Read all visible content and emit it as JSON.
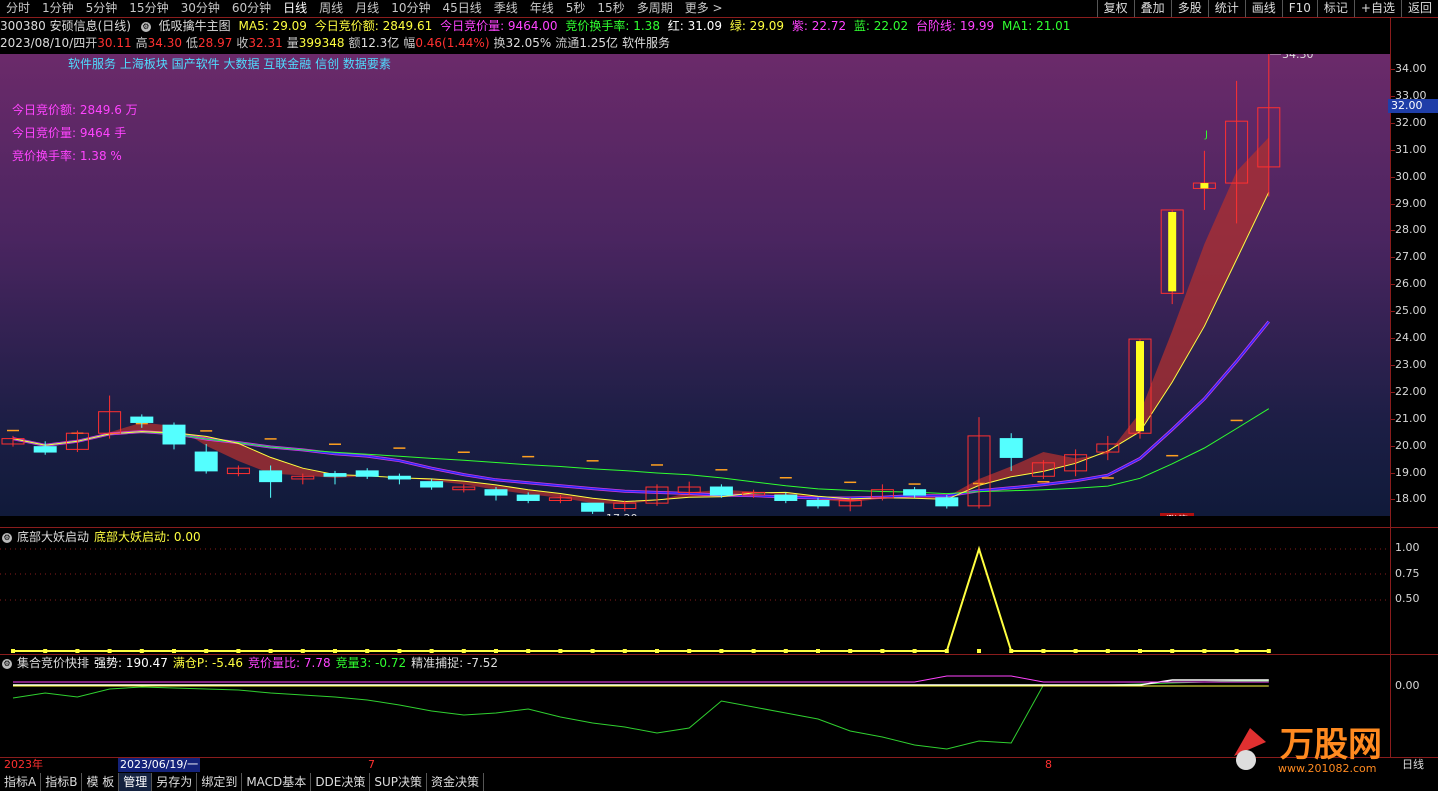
{
  "toolbar": {
    "tabs": [
      "分时",
      "1分钟",
      "5分钟",
      "15分钟",
      "30分钟",
      "60分钟",
      "日线",
      "周线",
      "月线",
      "10分钟",
      "45日线",
      "季线",
      "年线",
      "5秒",
      "15秒",
      "多周期",
      "更多 >"
    ],
    "active_tab": "日线",
    "right_buttons": [
      "复权",
      "叠加",
      "多股",
      "统计",
      "画线",
      "F10",
      "标记",
      "+自选",
      "返回"
    ]
  },
  "header": {
    "stock": "300380 安硕信息(日线)",
    "indicator": "低吸擒牛主图",
    "ma5": "MA5: 29.09",
    "auction_amount": "今日竞价额: 2849.61",
    "auction_volume": "今日竞价量: 9464.00",
    "auction_turnover": "竞价换手率: 1.38",
    "red": "红: 31.09",
    "green": "绿: 29.09",
    "purple": "紫: 22.72",
    "blue": "蓝: 22.02",
    "step_line": "台阶线: 19.99",
    "ma1": "MA1: 21.01"
  },
  "quote": {
    "date": "2023/08/10/四",
    "open_label": "开",
    "open": "30.11",
    "high_label": "高",
    "high": "34.30",
    "low_label": "低",
    "low": "28.97",
    "close_label": "收",
    "close": "32.31",
    "vol_label": "量",
    "vol": "399348",
    "amount_label": "额",
    "amount": "12.3亿",
    "change_label": "幅",
    "change": "0.46(1.44%)",
    "turnover_label": "换",
    "turnover": "32.05%",
    "float_label": "流通",
    "float": "1.25亿",
    "sector": "软件服务"
  },
  "concepts": "软件服务  上海板块  国产软件  大数据  互联金融  信创  数据要素",
  "stats": {
    "amount": "今日竞价额:  2849.6  万",
    "volume": "今日竞价量:  9464  手",
    "turnover": "竞价换手率:  1.38  %"
  },
  "price_axis": [
    "34.00",
    "33.00",
    "32.00",
    "31.00",
    "30.00",
    "29.00",
    "28.00",
    "27.00",
    "26.00",
    "25.00",
    "24.00",
    "23.00",
    "22.00",
    "21.00",
    "20.00",
    "19.00",
    "18.00"
  ],
  "current_price": "32.00",
  "high_marker": "34.30",
  "low_marker": "17.20",
  "limit_tag": "涨停",
  "j_marker": "J",
  "panel2": {
    "name": "底部大妖启动",
    "label": "底部大妖启动: 0.00",
    "axis": [
      "1.00",
      "0.75",
      "0.50"
    ]
  },
  "panel3": {
    "name": "集合竞价快排",
    "strength": "强势: 190.47",
    "full": "满仓P: -5.46",
    "ratio": "竞价量比: 7.78",
    "vol3": "竞量3: -0.72",
    "catch": "精准捕捉: -7.52",
    "axis": [
      "0.00"
    ]
  },
  "dates": {
    "year": "2023年",
    "cursor": "2023/06/19/一",
    "m7": "7",
    "m8": "8",
    "period": "日线"
  },
  "bottom_tabs": [
    "指标A",
    "指标B",
    "模 板",
    "管理",
    "另存为",
    "绑定到",
    "MACD基本",
    "DDE决策",
    "SUP决策",
    "资金决策"
  ],
  "active_bottom": "管理",
  "logo_text": "万股网",
  "logo_url": "www.201082.com",
  "colors": {
    "up": "#ff3030",
    "down": "#54ffff",
    "ma_yellow": "#ffff40",
    "magenta": "#ff44ff",
    "cyan": "#4fdcff",
    "green": "#30ff30"
  },
  "chart_data": {
    "type": "candlestick",
    "ylim": [
      17,
      34.5
    ],
    "candles": [
      {
        "o": 19.8,
        "c": 20.0,
        "h": 20.1,
        "l": 19.7
      },
      {
        "o": 19.7,
        "c": 19.5,
        "h": 19.9,
        "l": 19.4
      },
      {
        "o": 19.6,
        "c": 20.2,
        "h": 20.3,
        "l": 19.5
      },
      {
        "o": 20.2,
        "c": 21.0,
        "h": 21.6,
        "l": 20.0
      },
      {
        "o": 20.8,
        "c": 20.6,
        "h": 20.9,
        "l": 20.4
      },
      {
        "o": 20.5,
        "c": 19.8,
        "h": 20.6,
        "l": 19.6
      },
      {
        "o": 19.5,
        "c": 18.8,
        "h": 19.8,
        "l": 18.7
      },
      {
        "o": 18.7,
        "c": 18.9,
        "h": 19.0,
        "l": 18.6
      },
      {
        "o": 18.8,
        "c": 18.4,
        "h": 19.0,
        "l": 17.8
      },
      {
        "o": 18.5,
        "c": 18.6,
        "h": 18.7,
        "l": 18.3
      },
      {
        "o": 18.7,
        "c": 18.6,
        "h": 18.8,
        "l": 18.3
      },
      {
        "o": 18.8,
        "c": 18.6,
        "h": 18.9,
        "l": 18.5
      },
      {
        "o": 18.6,
        "c": 18.5,
        "h": 18.7,
        "l": 18.3
      },
      {
        "o": 18.4,
        "c": 18.2,
        "h": 18.5,
        "l": 18.1
      },
      {
        "o": 18.1,
        "c": 18.2,
        "h": 18.3,
        "l": 18.0
      },
      {
        "o": 18.1,
        "c": 17.9,
        "h": 18.2,
        "l": 17.7
      },
      {
        "o": 17.9,
        "c": 17.7,
        "h": 18.0,
        "l": 17.6
      },
      {
        "o": 17.7,
        "c": 17.8,
        "h": 17.9,
        "l": 17.6
      },
      {
        "o": 17.6,
        "c": 17.3,
        "h": 17.6,
        "l": 17.2
      },
      {
        "o": 17.4,
        "c": 17.6,
        "h": 17.7,
        "l": 17.3
      },
      {
        "o": 17.6,
        "c": 18.2,
        "h": 18.3,
        "l": 17.5
      },
      {
        "o": 18.0,
        "c": 18.2,
        "h": 18.4,
        "l": 17.9
      },
      {
        "o": 18.2,
        "c": 17.9,
        "h": 18.3,
        "l": 17.8
      },
      {
        "o": 17.9,
        "c": 18.0,
        "h": 18.1,
        "l": 17.8
      },
      {
        "o": 17.9,
        "c": 17.7,
        "h": 18.0,
        "l": 17.6
      },
      {
        "o": 17.7,
        "c": 17.5,
        "h": 17.8,
        "l": 17.4
      },
      {
        "o": 17.5,
        "c": 17.7,
        "h": 17.8,
        "l": 17.3
      },
      {
        "o": 17.8,
        "c": 18.1,
        "h": 18.3,
        "l": 17.7
      },
      {
        "o": 18.1,
        "c": 17.9,
        "h": 18.2,
        "l": 17.8
      },
      {
        "o": 17.8,
        "c": 17.5,
        "h": 17.9,
        "l": 17.4
      },
      {
        "o": 17.5,
        "c": 20.1,
        "h": 20.8,
        "l": 17.4
      },
      {
        "o": 20.0,
        "c": 19.3,
        "h": 20.2,
        "l": 18.8
      },
      {
        "o": 18.6,
        "c": 19.1,
        "h": 19.2,
        "l": 18.5
      },
      {
        "o": 18.8,
        "c": 19.4,
        "h": 19.6,
        "l": 18.6
      },
      {
        "o": 19.5,
        "c": 19.8,
        "h": 20.1,
        "l": 19.2
      },
      {
        "o": 20.2,
        "c": 23.7,
        "h": 23.7,
        "l": 20.0
      },
      {
        "o": 25.4,
        "c": 28.5,
        "h": 28.5,
        "l": 25.0
      },
      {
        "o": 29.3,
        "c": 29.5,
        "h": 30.7,
        "l": 28.5
      },
      {
        "o": 29.5,
        "c": 31.8,
        "h": 33.3,
        "l": 28.0
      },
      {
        "o": 30.1,
        "c": 32.3,
        "h": 34.3,
        "l": 29.0
      }
    ]
  }
}
